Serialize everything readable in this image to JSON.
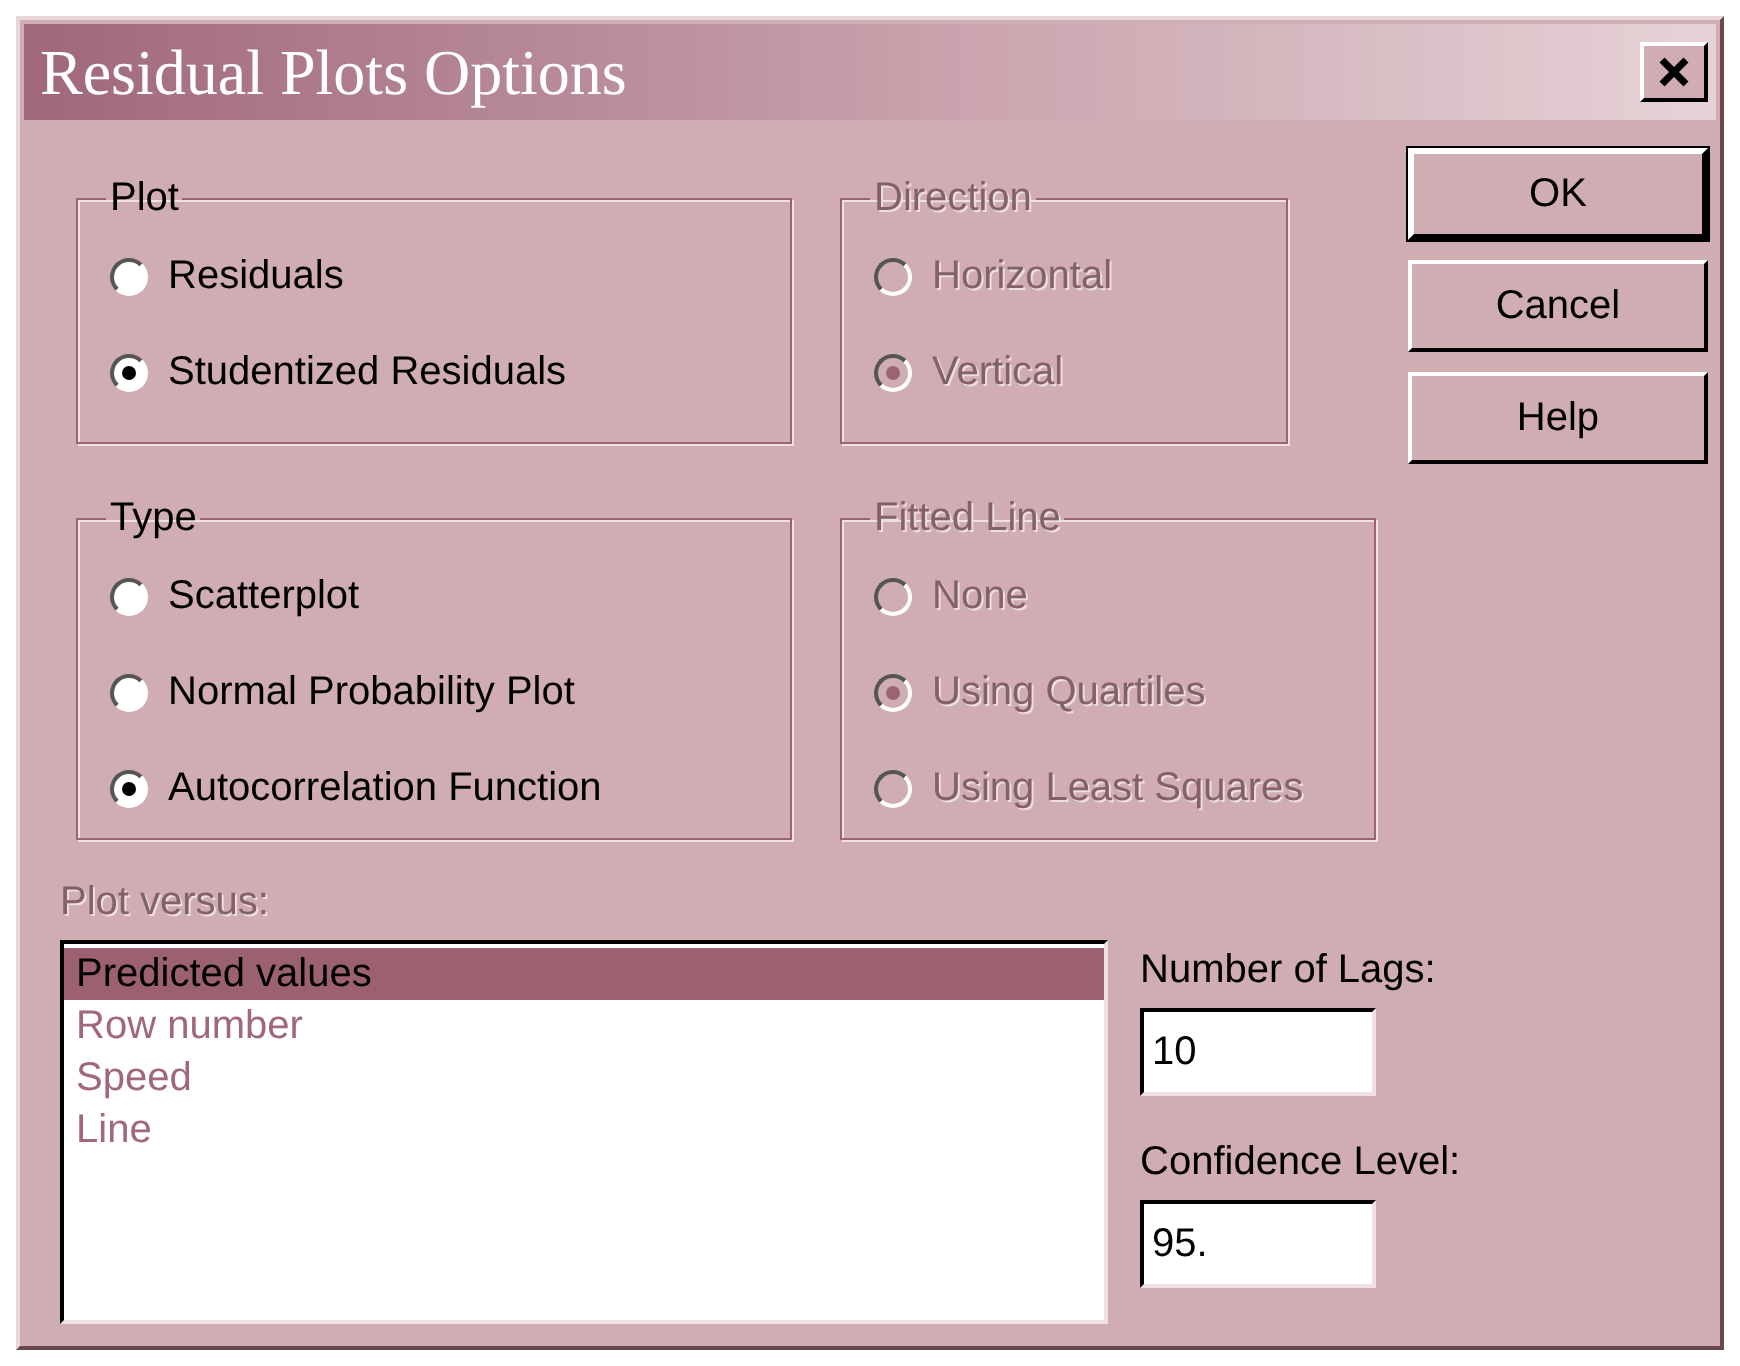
{
  "window": {
    "title": "Residual Plots Options"
  },
  "groups": [
    {
      "label": "Plot",
      "disabled": false,
      "options": [
        {
          "label": "Residuals",
          "selected": false
        },
        {
          "label": "Studentized Residuals",
          "selected": true
        }
      ]
    },
    {
      "label": "Direction",
      "disabled": true,
      "options": [
        {
          "label": "Horizontal",
          "selected": false
        },
        {
          "label": "Vertical",
          "selected": true
        }
      ]
    },
    {
      "label": "Type",
      "disabled": false,
      "options": [
        {
          "label": "Scatterplot",
          "selected": false
        },
        {
          "label": "Normal Probability Plot",
          "selected": false
        },
        {
          "label": "Autocorrelation Function",
          "selected": true
        }
      ]
    },
    {
      "label": "Fitted Line",
      "disabled": true,
      "options": [
        {
          "label": "None",
          "selected": false
        },
        {
          "label": "Using Quartiles",
          "selected": true
        },
        {
          "label": "Using Least Squares",
          "selected": false
        }
      ]
    }
  ],
  "buttons": [
    {
      "label": "OK",
      "default": true
    },
    {
      "label": "Cancel",
      "default": false
    },
    {
      "label": "Help",
      "default": false
    }
  ],
  "plot_versus": {
    "label": "Plot versus:",
    "disabled": true,
    "items": [
      {
        "label": "Predicted values",
        "selected": true
      },
      {
        "label": "Row number",
        "selected": false
      },
      {
        "label": "Speed",
        "selected": false
      },
      {
        "label": "Line",
        "selected": false
      }
    ]
  },
  "fields": [
    {
      "label": "Number of Lags:",
      "value": "10"
    },
    {
      "label": "Confidence Level:",
      "value": "95."
    }
  ]
}
